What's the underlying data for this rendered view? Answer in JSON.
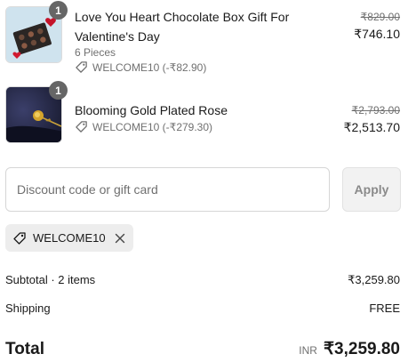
{
  "items": [
    {
      "title_line1": "Love You Heart Chocolate Box Gift For",
      "title_line2": "Valentine's Day",
      "variant": "6 Pieces",
      "discount": "WELCOME10 (-₹82.90)",
      "original_price": "₹829.00",
      "price": "₹746.10",
      "quantity": "1",
      "image_icon": "chocolate-box-image"
    },
    {
      "title_line1": "Blooming Gold Plated Rose",
      "discount": "WELCOME10 (-₹279.30)",
      "original_price": "₹2,793.00",
      "price": "₹2,513.70",
      "quantity": "1",
      "image_icon": "gold-rose-image"
    }
  ],
  "discount_input": {
    "placeholder": "Discount code or gift card",
    "value": ""
  },
  "apply_label": "Apply",
  "applied_code": "WELCOME10",
  "summary": {
    "subtotal_label": "Subtotal · 2 items",
    "subtotal_value": "₹3,259.80",
    "shipping_label": "Shipping",
    "shipping_value": "FREE",
    "total_label": "Total",
    "currency": "INR",
    "total_value": "₹3,259.80"
  },
  "colors": {
    "text": "#1a1a1a",
    "muted": "#707070",
    "badge": "#666666",
    "chip_bg": "#ededed"
  }
}
